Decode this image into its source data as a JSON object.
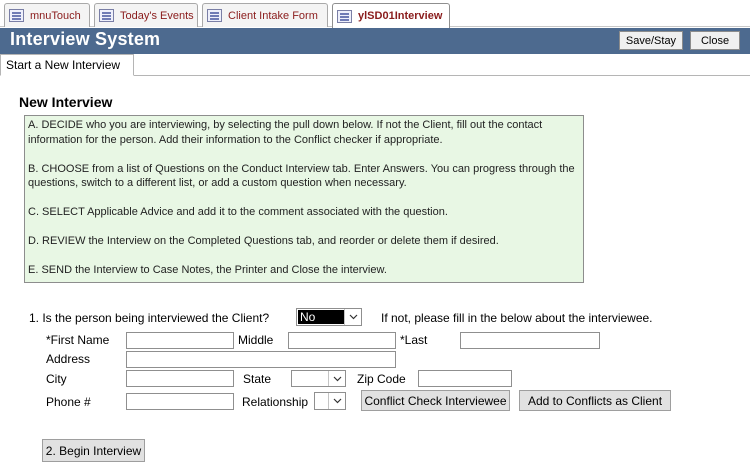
{
  "doc_tabs": [
    {
      "label": "mnuTouch"
    },
    {
      "label": "Today's Events"
    },
    {
      "label": "Client Intake Form"
    },
    {
      "label": "ylSD01Interview"
    }
  ],
  "header": {
    "title": "Interview System",
    "save_label": "Save/Stay",
    "close_label": "Close"
  },
  "page_tab": {
    "label": "Start a New Interview"
  },
  "section": {
    "title": "New Interview"
  },
  "instructions": [
    "A. DECIDE who you are interviewing, by selecting the pull down below. If not the Client, fill out the contact information for the person. Add their information to the Conflict checker if  appropriate.",
    "B. CHOOSE from a list of Questions on the Conduct Interview tab. Enter Answers. You can progress through the questions, switch to a different list, or add a custom question when necessary.",
    "C. SELECT Applicable Advice and add it to the comment associated with the question.",
    "D. REVIEW the Interview on the Completed Questions tab, and reorder or delete them if desired.",
    "E. SEND the Interview to Case Notes, the Printer and Close the interview."
  ],
  "question": {
    "label": "1. Is the person being interviewed the Client?",
    "value": "No",
    "hint": "If not, please fill in the below about the interviewee."
  },
  "form": {
    "first_name_label": "*First Name",
    "middle_label": "Middle",
    "last_label": "*Last",
    "address_label": "Address",
    "city_label": "City",
    "state_label": "State",
    "zip_label": "Zip Code",
    "phone_label": "Phone #",
    "relationship_label": "Relationship",
    "first_name": "",
    "middle": "",
    "last": "",
    "address": "",
    "city": "",
    "state": "",
    "zip": "",
    "phone": "",
    "relationship": ""
  },
  "buttons": {
    "conflict_check": "Conflict Check Interviewee",
    "add_conflicts": "Add  to Conflicts as Client",
    "begin_interview": "2. Begin Interview"
  },
  "colors": {
    "header_bg": "#4d6a8f",
    "instructions_bg": "#e8f7e4",
    "tab_text": "#8a1c1c"
  }
}
